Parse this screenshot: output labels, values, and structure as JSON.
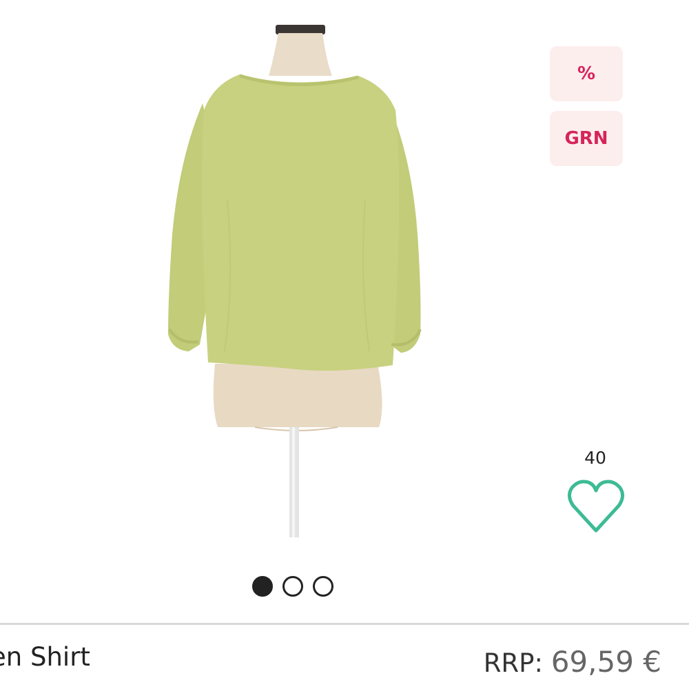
{
  "badges": {
    "discount": "%",
    "tag": "GRN"
  },
  "likes": {
    "count": "40"
  },
  "carousel": {
    "total": 3,
    "active_index": 0
  },
  "product": {
    "title": "en Shirt",
    "rrp_label": "RRP:",
    "rrp_value": "69,59 €"
  },
  "colors": {
    "badge_bg": "#fdeeee",
    "badge_text": "#d6245a",
    "heart": "#3dbb94",
    "shirt": "#c5cf7d"
  },
  "icons": {
    "like": "heart-outline-icon"
  }
}
